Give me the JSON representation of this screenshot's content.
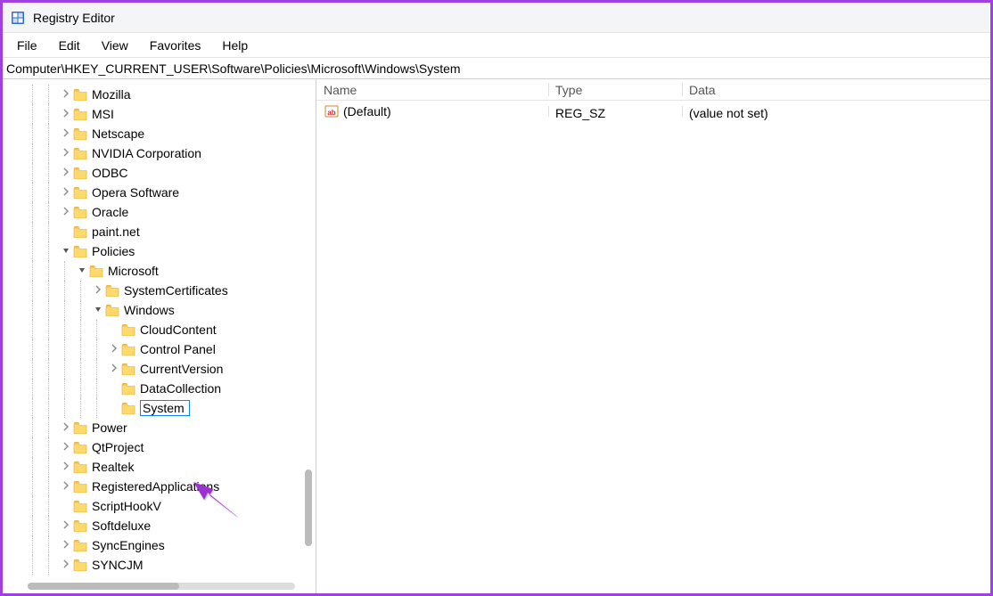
{
  "window": {
    "title": "Registry Editor"
  },
  "menu": {
    "file": "File",
    "edit": "Edit",
    "view": "View",
    "favorites": "Favorites",
    "help": "Help"
  },
  "address": "Computer\\HKEY_CURRENT_USER\\Software\\Policies\\Microsoft\\Windows\\System",
  "tree": [
    {
      "label": "Mozilla",
      "depth": 3,
      "expander": ">"
    },
    {
      "label": "MSI",
      "depth": 3,
      "expander": ">"
    },
    {
      "label": "Netscape",
      "depth": 3,
      "expander": ">"
    },
    {
      "label": "NVIDIA Corporation",
      "depth": 3,
      "expander": ">"
    },
    {
      "label": "ODBC",
      "depth": 3,
      "expander": ">"
    },
    {
      "label": "Opera Software",
      "depth": 3,
      "expander": ">"
    },
    {
      "label": "Oracle",
      "depth": 3,
      "expander": ">"
    },
    {
      "label": "paint.net",
      "depth": 3,
      "expander": ""
    },
    {
      "label": "Policies",
      "depth": 3,
      "expander": "v"
    },
    {
      "label": "Microsoft",
      "depth": 4,
      "expander": "v"
    },
    {
      "label": "SystemCertificates",
      "depth": 5,
      "expander": ">"
    },
    {
      "label": "Windows",
      "depth": 5,
      "expander": "v"
    },
    {
      "label": "CloudContent",
      "depth": 6,
      "expander": ""
    },
    {
      "label": "Control Panel",
      "depth": 6,
      "expander": ">"
    },
    {
      "label": "CurrentVersion",
      "depth": 6,
      "expander": ">"
    },
    {
      "label": "DataCollection",
      "depth": 6,
      "expander": ""
    },
    {
      "label": "System",
      "depth": 6,
      "expander": "",
      "editing": true
    },
    {
      "label": "Power",
      "depth": 3,
      "expander": ">"
    },
    {
      "label": "QtProject",
      "depth": 3,
      "expander": ">"
    },
    {
      "label": "Realtek",
      "depth": 3,
      "expander": ">"
    },
    {
      "label": "RegisteredApplications",
      "depth": 3,
      "expander": ">"
    },
    {
      "label": "ScriptHookV",
      "depth": 3,
      "expander": ""
    },
    {
      "label": "Softdeluxe",
      "depth": 3,
      "expander": ">"
    },
    {
      "label": "SyncEngines",
      "depth": 3,
      "expander": ">"
    },
    {
      "label": "SYNCJM",
      "depth": 3,
      "expander": ">"
    }
  ],
  "columns": {
    "name": "Name",
    "type": "Type",
    "data": "Data"
  },
  "values": [
    {
      "name": "(Default)",
      "type": "REG_SZ",
      "data": "(value not set)"
    }
  ]
}
